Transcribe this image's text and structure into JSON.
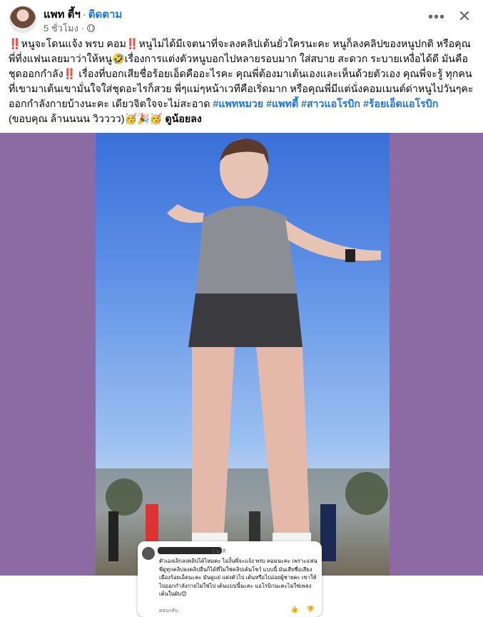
{
  "post": {
    "author": "แพท ตี้ฯ",
    "follow_label": "ติดตาม",
    "time": "5 ชั่วโมง",
    "caption_lines": [
      "‼️หนูจะโดนแจ้ง พรบ คอม‼️หนูไม่ได้มีเจตนาที่จะลงคลิปเต้นยั่วใครนะคะ หนูก็ลงคลิปของหนูปกติ หรือคุณ",
      "พี่ที่งแฟนเลยมาว่าให้หนู🤣เรื่องการแต่งตัวหนูบอกไปหลายรอบมาก ใส่สบาย สะดวก ระบายเหงื่อได้ดี มันคือ",
      "ชุดออกกำลัง‼️ เรื่องที่บอกเสียชื่อร้อยเอ็ดคืออะไรคะ คุณพี่ต้องมาเต้นเองและเห็นด้วยตัวเอง คุณพี่จะรู้ ทุกคน",
      "ที่เขามาเต้นเขามั่นใจใส่ชุดอะไรก็สวย พี่ๆแม่ๆหน้าเวทีคือเริ่ดมาก หรือคุณพี่มีแต่นั่งคอมเมนต์ด่าหนูไปวันๆคะ"
    ],
    "caption_line5_prefix": "ออกกำลังกายบ้างนะคะ เดียวจิตใจจะไม่สะอาด ",
    "hashtags": [
      "#แพทหมวย",
      "#แพทตี้",
      "#สาวแอโรบิก",
      "#ร้อยเอ็ดแอโรบิก"
    ],
    "caption_line6_prefix": "(ขอบคุณ ล้านนนน วิวววว)🥳🎉🥳 ",
    "caption_line6_bold": "ดูน้อยลง"
  },
  "comment_screenshot": {
    "time": "1 นาที",
    "text": "ตัวเองเลิกลงคลิปได้ไหมคะ ไม่งั้นพี่จะแจ้ง พรบ คอมนะคะ เพราะแฟนพี่ดูทุกคลิปลงคลิปอื่นก็ได้ที่ไม่ใช่คลิปเต้นโชว์ แบบนี้ มันเสียชื่อเสียงเมืองร้อยเอ็ดนะคะ มันดูแย่ แต่งตัวไป เต้นหรือไปอ่อยผู้ชายคะ เขาให้ไปออกกำลังกายไม่ใช่ไป เต้นแบบนี้นะคะ แอโรบิกนะคะไม่ใช่เพลงเต้นในผับ😊",
    "reply_label": "ตอบกลับ"
  },
  "colors": {
    "accent": "#1b74e4",
    "media_bg": "#8c6aa4"
  }
}
